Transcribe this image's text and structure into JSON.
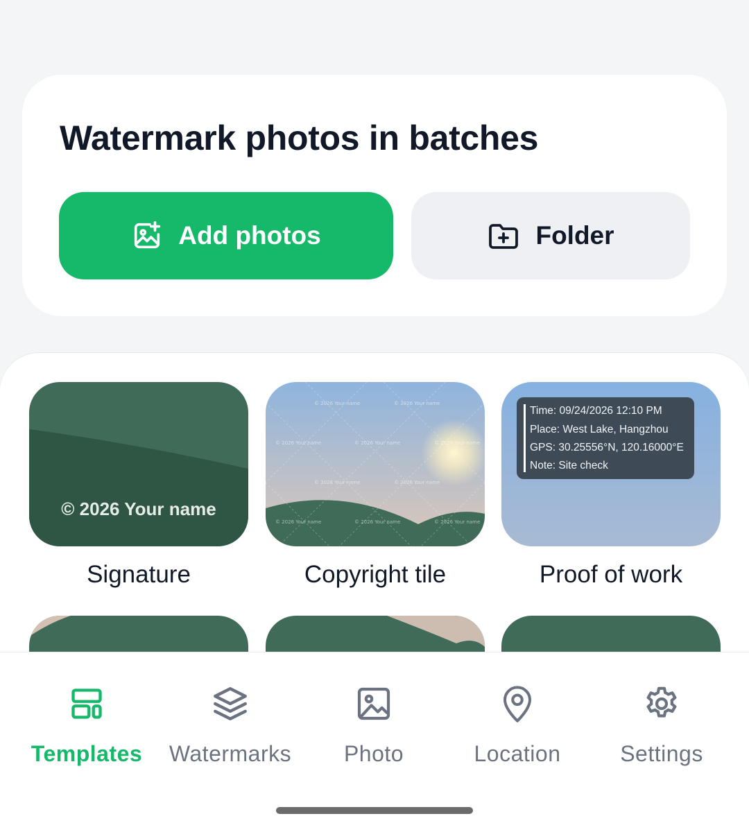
{
  "batch_card": {
    "title": "Watermark photos in batches",
    "add_photos_label": "Add photos",
    "folder_label": "Folder"
  },
  "templates": [
    {
      "label": "Signature",
      "preview_text": "© 2026 Your name"
    },
    {
      "label": "Copyright tile",
      "preview_text": "© 2026 Your name"
    },
    {
      "label": "Proof of work",
      "preview_lines": [
        "Time: 09/24/2026 12:10 PM",
        "Place: West Lake, Hangzhou",
        "GPS: 30.25556°N, 120.16000°E",
        "Note: Site check"
      ]
    }
  ],
  "nav": {
    "items": [
      {
        "label": "Templates",
        "icon": "templates-icon",
        "active": true
      },
      {
        "label": "Watermarks",
        "icon": "layers-icon",
        "active": false
      },
      {
        "label": "Photo",
        "icon": "photo-icon",
        "active": false
      },
      {
        "label": "Location",
        "icon": "location-pin-icon",
        "active": false
      },
      {
        "label": "Settings",
        "icon": "gear-icon",
        "active": false
      }
    ]
  },
  "colors": {
    "accent": "#16b86a",
    "nav_inactive": "#6b7280",
    "text": "#111827",
    "tile_green": "#3f6b58"
  }
}
